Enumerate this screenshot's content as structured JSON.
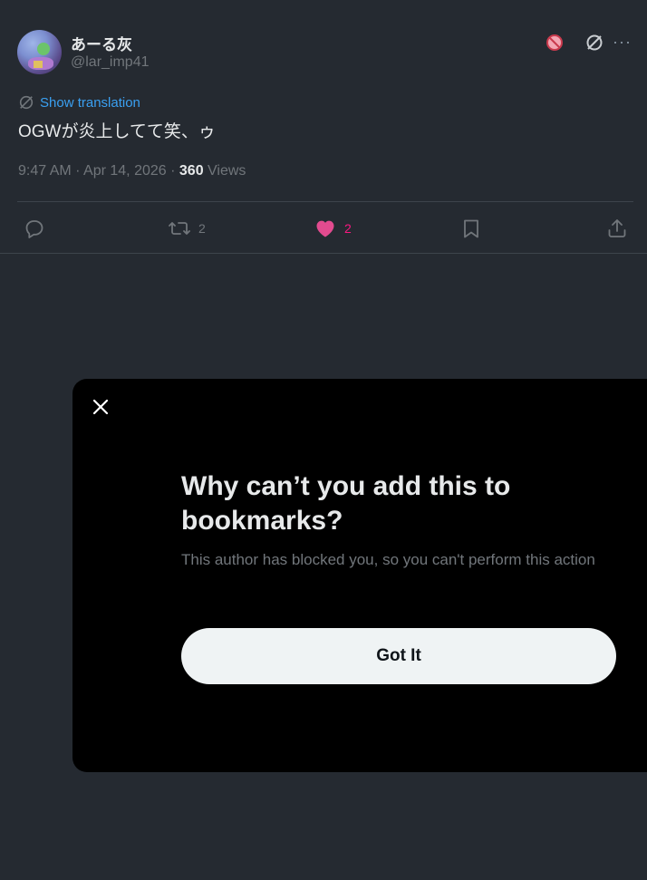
{
  "post": {
    "display_name": "あーる灰",
    "handle": "@lar_imp41",
    "translation_label": "Show translation",
    "text": "OGWが炎上してて笑、ゥ",
    "timestamp": "9:47 AM · Apr 14, 2026 · ",
    "views_count": "360",
    "views_label": " Views",
    "more_label": "···"
  },
  "actions": {
    "reply_count": "",
    "repost_count": "2",
    "like_count": "2",
    "bookmark_count": "",
    "share_count": ""
  },
  "modal": {
    "title": "Why can’t you add this to bookmarks?",
    "body": "This author has blocked you, so you can't perform this action",
    "button_label": "Got It"
  },
  "colors": {
    "background": "#252a31",
    "accent_link": "#3aa0f2",
    "like": "#f91880",
    "modal_bg": "#000000",
    "button_bg": "#eff3f4"
  },
  "icons": [
    "block-icon",
    "grok-icon",
    "more-icon",
    "translate-icon",
    "reply-icon",
    "repost-icon",
    "like-icon",
    "bookmark-icon",
    "share-icon",
    "close-icon"
  ]
}
